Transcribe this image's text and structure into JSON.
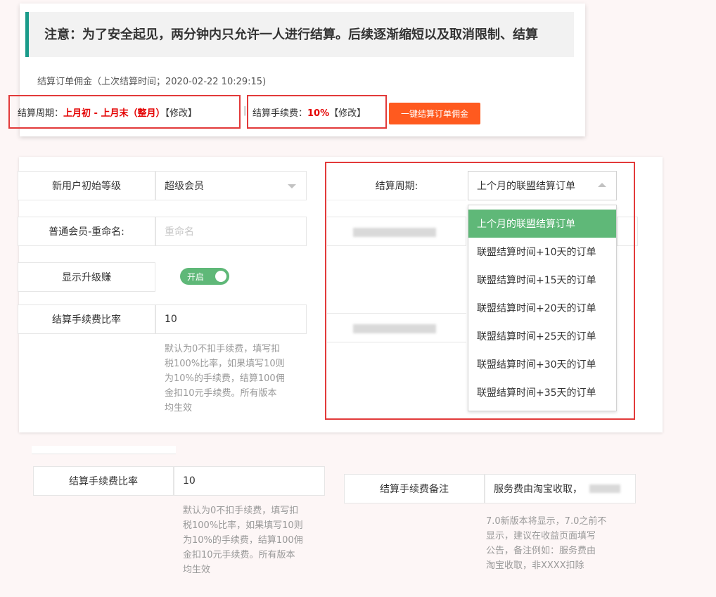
{
  "notice": {
    "text": "注意：为了安全起见，两分钟内只允许一人进行结算。后续逐渐缩短以及取消限制、结算"
  },
  "settle_order": {
    "last_time_text": "结算订单佣金（上次结算时间；2020-02-22 10:29:15)",
    "cycle_label": "结算周期：",
    "cycle_value": "上月初 - 上月末（整月）",
    "edit_label": "【修改】",
    "separator": "|",
    "fee_label": "结算手续费：",
    "fee_value": "10%",
    "one_click_button": "一键结算订单佣金"
  },
  "form": {
    "new_user_level_label": "新用户初始等级",
    "new_user_level_value": "超级会员",
    "rename_label": "普通会员-重命名:",
    "rename_placeholder": "重命名",
    "show_upgrade_label": "显示升级赚",
    "toggle_text": "开启",
    "fee_rate_label": "结算手续费比率",
    "fee_rate_value": "10",
    "fee_rate_help": [
      "默认为0不扣手续费，填写扣",
      "税100%比率，如果填写10则",
      "为10%的手续费，结算100佣",
      "金扣10元手续费。所有版本",
      "均生效"
    ],
    "cycle_label": "结算周期:",
    "cycle_selected": "上个月的联盟结算订单",
    "cycle_options": [
      "上个月的联盟结算订单",
      "联盟结算时间+10天的订单",
      "联盟结算时间+15天的订单",
      "联盟结算时间+20天的订单",
      "联盟结算时间+25天的订单",
      "联盟结算时间+30天的订单",
      "联盟结算时间+35天的订单"
    ]
  },
  "form2": {
    "fee_rate_label": "结算手续费比率",
    "fee_rate_value": "10",
    "fee_rate_help": [
      "默认为0不扣手续费，填写扣",
      "税100%比率，如果填写10则",
      "为10%的手续费，结算100佣",
      "金扣10元手续费。所有版本",
      "均生效"
    ],
    "fee_remark_label": "结算手续费备注",
    "fee_remark_value": "服务费由淘宝收取，",
    "fee_remark_help": [
      "7.0新版本将显示，7.0之前不",
      "显示，建议在收益页面填写",
      "公告，备注例如：服务费由",
      "淘宝收取，非XXXX扣除"
    ]
  }
}
